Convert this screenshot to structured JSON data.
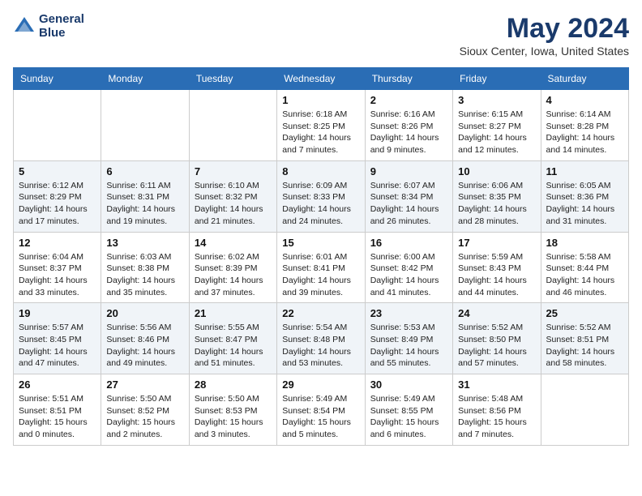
{
  "header": {
    "logo_line1": "General",
    "logo_line2": "Blue",
    "month_year": "May 2024",
    "location": "Sioux Center, Iowa, United States"
  },
  "weekdays": [
    "Sunday",
    "Monday",
    "Tuesday",
    "Wednesday",
    "Thursday",
    "Friday",
    "Saturday"
  ],
  "weeks": [
    [
      {
        "day": "",
        "info": ""
      },
      {
        "day": "",
        "info": ""
      },
      {
        "day": "",
        "info": ""
      },
      {
        "day": "1",
        "info": "Sunrise: 6:18 AM\nSunset: 8:25 PM\nDaylight: 14 hours\nand 7 minutes."
      },
      {
        "day": "2",
        "info": "Sunrise: 6:16 AM\nSunset: 8:26 PM\nDaylight: 14 hours\nand 9 minutes."
      },
      {
        "day": "3",
        "info": "Sunrise: 6:15 AM\nSunset: 8:27 PM\nDaylight: 14 hours\nand 12 minutes."
      },
      {
        "day": "4",
        "info": "Sunrise: 6:14 AM\nSunset: 8:28 PM\nDaylight: 14 hours\nand 14 minutes."
      }
    ],
    [
      {
        "day": "5",
        "info": "Sunrise: 6:12 AM\nSunset: 8:29 PM\nDaylight: 14 hours\nand 17 minutes."
      },
      {
        "day": "6",
        "info": "Sunrise: 6:11 AM\nSunset: 8:31 PM\nDaylight: 14 hours\nand 19 minutes."
      },
      {
        "day": "7",
        "info": "Sunrise: 6:10 AM\nSunset: 8:32 PM\nDaylight: 14 hours\nand 21 minutes."
      },
      {
        "day": "8",
        "info": "Sunrise: 6:09 AM\nSunset: 8:33 PM\nDaylight: 14 hours\nand 24 minutes."
      },
      {
        "day": "9",
        "info": "Sunrise: 6:07 AM\nSunset: 8:34 PM\nDaylight: 14 hours\nand 26 minutes."
      },
      {
        "day": "10",
        "info": "Sunrise: 6:06 AM\nSunset: 8:35 PM\nDaylight: 14 hours\nand 28 minutes."
      },
      {
        "day": "11",
        "info": "Sunrise: 6:05 AM\nSunset: 8:36 PM\nDaylight: 14 hours\nand 31 minutes."
      }
    ],
    [
      {
        "day": "12",
        "info": "Sunrise: 6:04 AM\nSunset: 8:37 PM\nDaylight: 14 hours\nand 33 minutes."
      },
      {
        "day": "13",
        "info": "Sunrise: 6:03 AM\nSunset: 8:38 PM\nDaylight: 14 hours\nand 35 minutes."
      },
      {
        "day": "14",
        "info": "Sunrise: 6:02 AM\nSunset: 8:39 PM\nDaylight: 14 hours\nand 37 minutes."
      },
      {
        "day": "15",
        "info": "Sunrise: 6:01 AM\nSunset: 8:41 PM\nDaylight: 14 hours\nand 39 minutes."
      },
      {
        "day": "16",
        "info": "Sunrise: 6:00 AM\nSunset: 8:42 PM\nDaylight: 14 hours\nand 41 minutes."
      },
      {
        "day": "17",
        "info": "Sunrise: 5:59 AM\nSunset: 8:43 PM\nDaylight: 14 hours\nand 44 minutes."
      },
      {
        "day": "18",
        "info": "Sunrise: 5:58 AM\nSunset: 8:44 PM\nDaylight: 14 hours\nand 46 minutes."
      }
    ],
    [
      {
        "day": "19",
        "info": "Sunrise: 5:57 AM\nSunset: 8:45 PM\nDaylight: 14 hours\nand 47 minutes."
      },
      {
        "day": "20",
        "info": "Sunrise: 5:56 AM\nSunset: 8:46 PM\nDaylight: 14 hours\nand 49 minutes."
      },
      {
        "day": "21",
        "info": "Sunrise: 5:55 AM\nSunset: 8:47 PM\nDaylight: 14 hours\nand 51 minutes."
      },
      {
        "day": "22",
        "info": "Sunrise: 5:54 AM\nSunset: 8:48 PM\nDaylight: 14 hours\nand 53 minutes."
      },
      {
        "day": "23",
        "info": "Sunrise: 5:53 AM\nSunset: 8:49 PM\nDaylight: 14 hours\nand 55 minutes."
      },
      {
        "day": "24",
        "info": "Sunrise: 5:52 AM\nSunset: 8:50 PM\nDaylight: 14 hours\nand 57 minutes."
      },
      {
        "day": "25",
        "info": "Sunrise: 5:52 AM\nSunset: 8:51 PM\nDaylight: 14 hours\nand 58 minutes."
      }
    ],
    [
      {
        "day": "26",
        "info": "Sunrise: 5:51 AM\nSunset: 8:51 PM\nDaylight: 15 hours\nand 0 minutes."
      },
      {
        "day": "27",
        "info": "Sunrise: 5:50 AM\nSunset: 8:52 PM\nDaylight: 15 hours\nand 2 minutes."
      },
      {
        "day": "28",
        "info": "Sunrise: 5:50 AM\nSunset: 8:53 PM\nDaylight: 15 hours\nand 3 minutes."
      },
      {
        "day": "29",
        "info": "Sunrise: 5:49 AM\nSunset: 8:54 PM\nDaylight: 15 hours\nand 5 minutes."
      },
      {
        "day": "30",
        "info": "Sunrise: 5:49 AM\nSunset: 8:55 PM\nDaylight: 15 hours\nand 6 minutes."
      },
      {
        "day": "31",
        "info": "Sunrise: 5:48 AM\nSunset: 8:56 PM\nDaylight: 15 hours\nand 7 minutes."
      },
      {
        "day": "",
        "info": ""
      }
    ]
  ]
}
